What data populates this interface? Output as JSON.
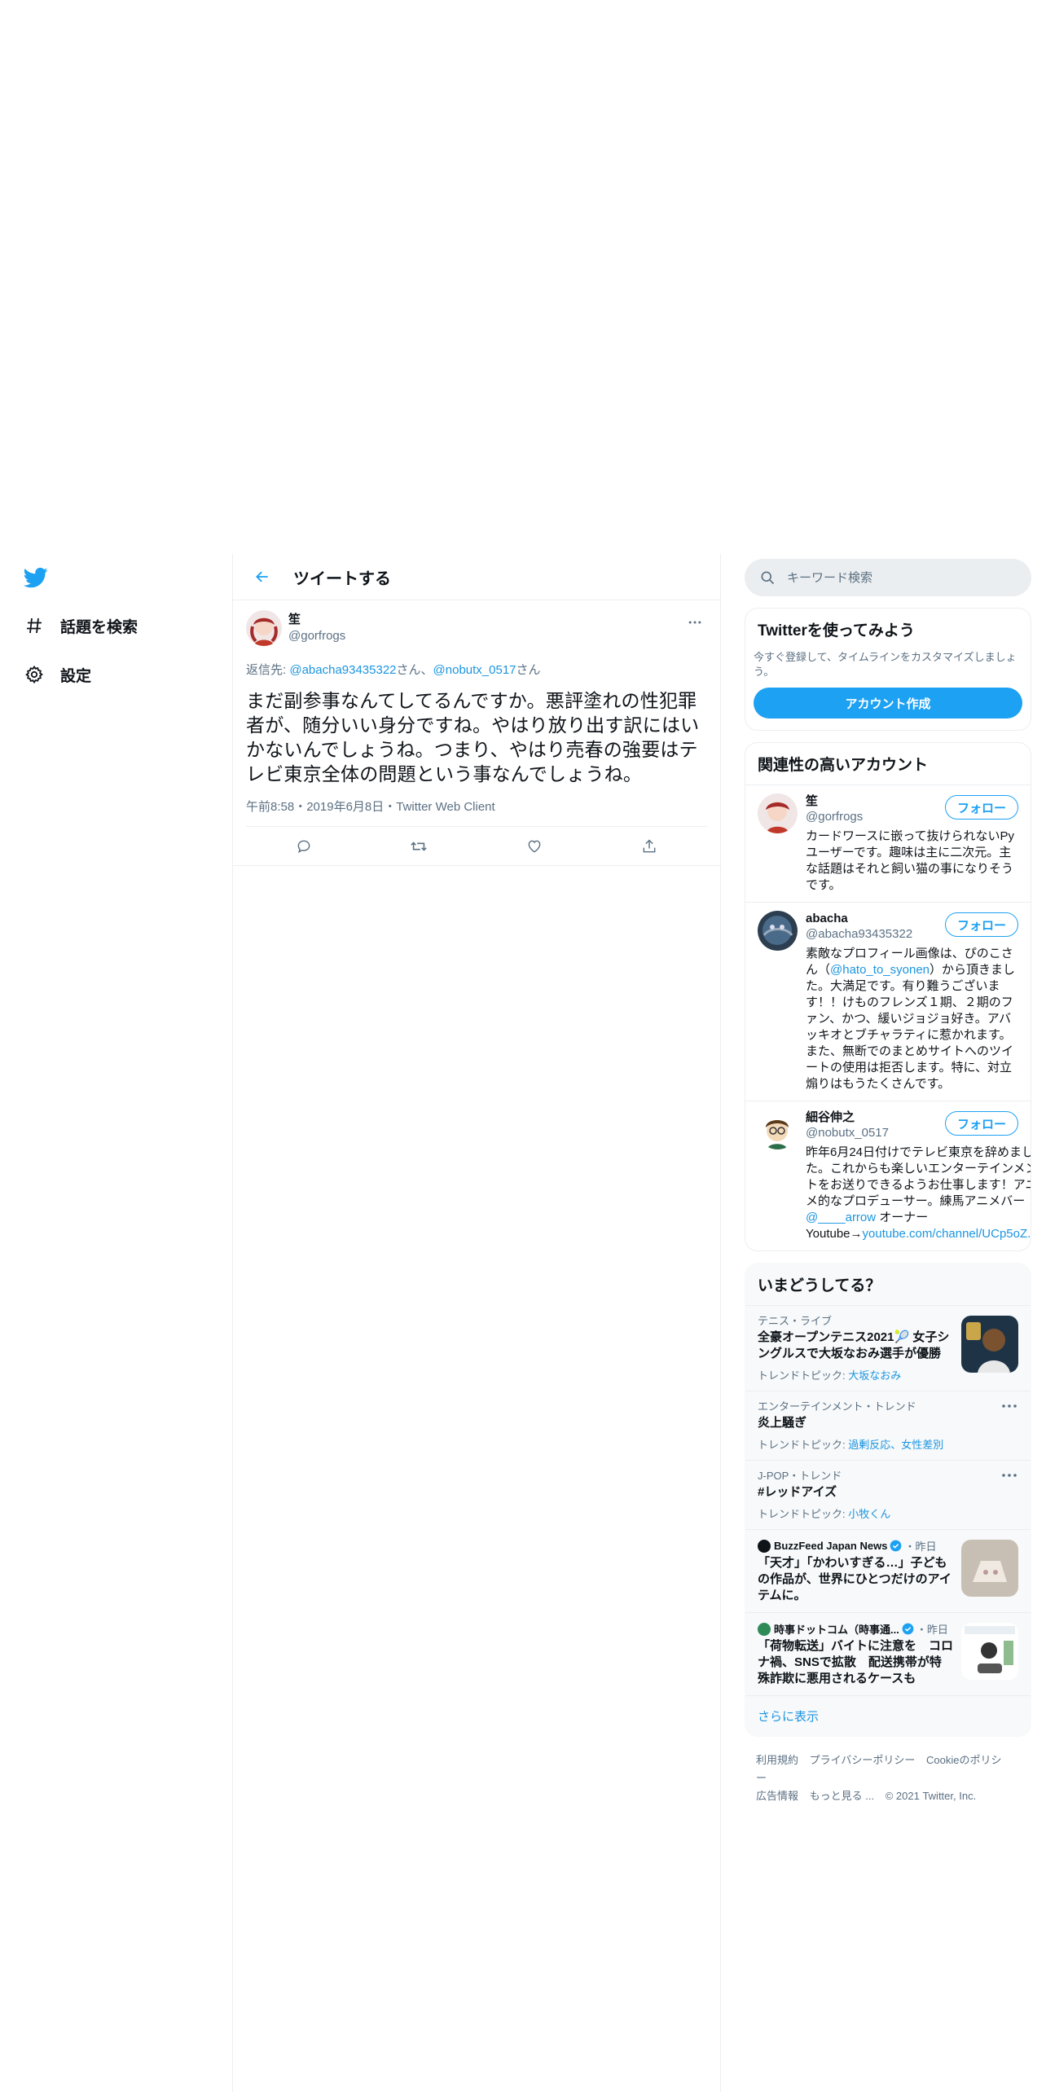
{
  "nav": {
    "explore_label": "話題を検索",
    "settings_label": "設定"
  },
  "header": {
    "title": "ツイートする"
  },
  "tweet": {
    "name": "笙",
    "handle": "@gorfrogs",
    "reply_prefix": "返信先: ",
    "reply_user1": "@abacha93435322",
    "reply_sep": "さん、",
    "reply_user2": "@nobutx_0517",
    "reply_suffix": "さん",
    "text": "まだ副参事なんてしてるんですか。悪評塗れの性犯罪者が、随分いい身分ですね。やはり放り出す訳にはいかないんでしょうね。つまり、やはり売春の強要はテレビ東京全体の問題という事なんでしょうね。",
    "meta": "午前8:58・2019年6月8日・Twitter Web Client"
  },
  "search": {
    "placeholder": "キーワード検索"
  },
  "signup": {
    "title": "Twitterを使ってみよう",
    "desc": "今すぐ登録して、タイムラインをカスタマイズしましょう。",
    "button": "アカウント作成"
  },
  "related": {
    "title": "関連性の高いアカウント",
    "follow_label": "フォロー",
    "accounts": [
      {
        "name": "笙",
        "handle": "@gorfrogs",
        "bio": "カードワースに嵌って抜けられないPyユーザーです。趣味は主に二次元。主な話題はそれと飼い猫の事になりそうです。"
      },
      {
        "name": "abacha",
        "handle": "@abacha93435322",
        "bio_pre": "素敵なプロフィール画像は、ぴのこさん（",
        "bio_link": "@hato_to_syonen",
        "bio_post": "）から頂きました。大満足です。有り難うございます！！けものフレンズ１期、２期のファン、かつ、緩いジョジョ好き。アバッキオとブチャラティに惹かれます。また、無断でのまとめサイトへのツイートの使用は拒否します。特に、対立煽りはもうたくさんです。"
      },
      {
        "name": "細谷伸之",
        "handle": "@nobutx_0517",
        "bio_pre": "昨年6月24日付けでテレビ東京を辞めました。これからも楽しいエンターテインメントをお送りできるようお仕事します！アニメ的なプロデューサー。練馬アニメバー ",
        "bio_link": "@____arrow",
        "bio_mid": " オーナー Youtube→",
        "bio_link2": "youtube.com/channel/UCp5oZ..."
      }
    ]
  },
  "trends": {
    "title": "いまどうしてる？",
    "items": [
      {
        "category": "テニス・ライブ",
        "title": "全豪オープンテニス2021🎾 女子シングルスで大坂なおみ選手が優勝",
        "sub_label": "トレンドトピック: ",
        "sub_links": "大坂なおみ"
      },
      {
        "category": "エンターテインメント・トレンド",
        "title": "炎上騒ぎ",
        "sub_label": "トレンドトピック: ",
        "sub_links": "過剰反応、女性差別"
      },
      {
        "category": "J-POP・トレンド",
        "title": "#レッドアイズ",
        "sub_label": "トレンドトピック: ",
        "sub_links": "小牧くん"
      },
      {
        "source": "BuzzFeed Japan News",
        "time": "・昨日",
        "title": "「天才」「かわいすぎる…」子どもの作品が、世界にひとつだけのアイテムに。"
      },
      {
        "source": "時事ドットコム（時事通...",
        "time": "・昨日",
        "title": "「荷物転送」バイトに注意を　コロナ禍、SNSで拡散　配送携帯が特殊詐欺に悪用されるケースも"
      }
    ],
    "show_more": "さらに表示"
  },
  "footer": {
    "terms": "利用規約",
    "privacy": "プライバシーポリシー",
    "cookie": "Cookieのポリシー",
    "ads": "広告情報",
    "more": "もっと見る ...",
    "copyright": "© 2021 Twitter, Inc."
  },
  "colors": {
    "accent": "#1da1f2",
    "link": "#1b95e0",
    "muted": "#5b7083"
  }
}
